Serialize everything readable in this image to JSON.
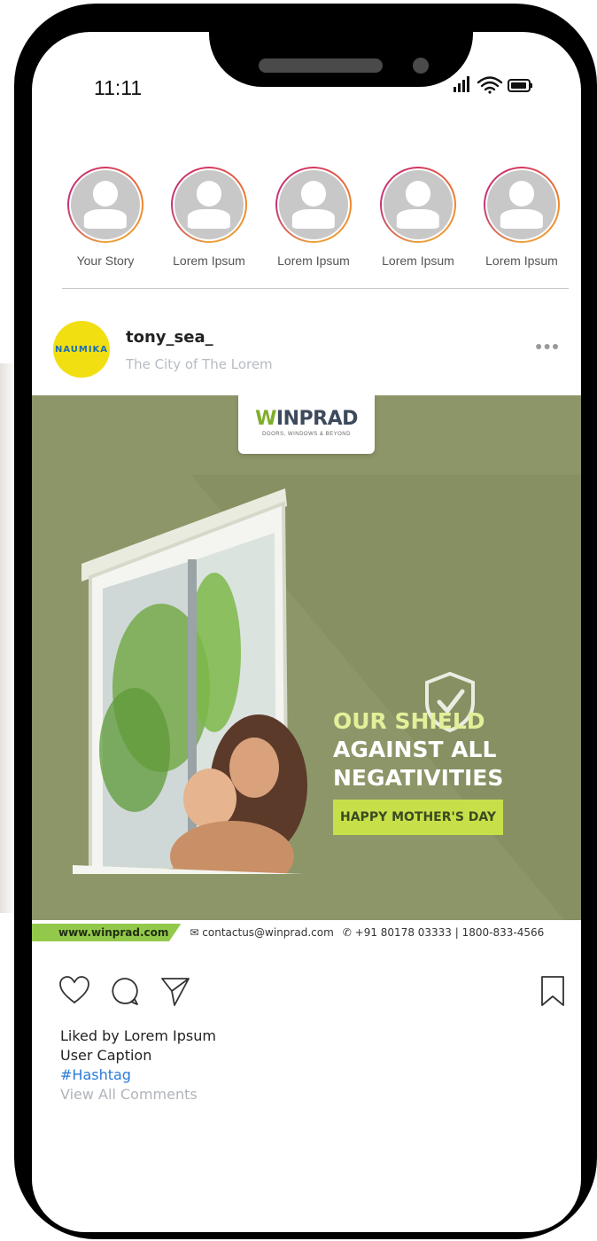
{
  "status_bar": {
    "time": "11:11"
  },
  "stories": [
    {
      "label": "Your Story"
    },
    {
      "label": "Lorem Ipsum"
    },
    {
      "label": "Lorem Ipsum"
    },
    {
      "label": "Lorem Ipsum"
    },
    {
      "label": "Lorem Ipsum"
    }
  ],
  "post": {
    "username": "tony_sea_",
    "location": "The City of The Lorem",
    "avatar_text": "NAUMIKA",
    "image": {
      "logo_main": "INPRAD",
      "logo_prefix": "W",
      "logo_tagline": "DOORS, WINDOWS & BEYOND",
      "tagline_line1": "OUR SHIELD",
      "tagline_line2": "AGAINST ALL",
      "tagline_line3": "NEGATIVITIES",
      "badge": "HAPPY MOTHER'S DAY",
      "footer_url": "www.winprad.com",
      "footer_email": "contactus@winprad.com",
      "footer_phone": "+91 80178 03333 | 1800-833-4566"
    },
    "liked_by": "Liked by Lorem Ipsum",
    "caption": "User Caption",
    "hashtag": "#Hashtag",
    "view_all": "View All Comments"
  },
  "colors": {
    "story_ring_start": "#d3365e",
    "story_ring_end": "#f08a2a",
    "post_bg": "#8d9668",
    "accent_green": "#93c94a",
    "hashtag": "#2b7bd6"
  }
}
